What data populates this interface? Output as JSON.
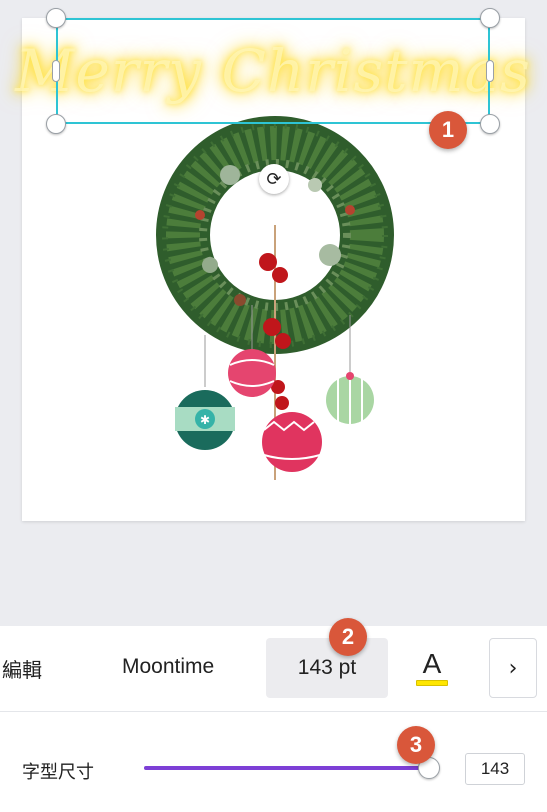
{
  "canvas": {
    "text_element": "Merry Christmas",
    "wreath_image": "christmas-wreath-with-ornaments",
    "rotate_icon": "rotate-icon"
  },
  "annotations": {
    "marker_1": "1",
    "marker_2": "2",
    "marker_3": "3"
  },
  "toolbar": {
    "edit_label": "編輯",
    "font_name": "Moontime",
    "font_size": "143 pt",
    "text_color_letter": "A",
    "text_color": "#ffe600",
    "next_icon": "chevron-right-icon",
    "next_glyph": "›"
  },
  "size_slider": {
    "label": "字型尺寸",
    "value": "143",
    "fill_fraction": 0.99,
    "accent": "#7d3fd6"
  },
  "colors": {
    "selection": "#2ec4d4",
    "marker": "#d9573a",
    "background": "#ebecf0"
  }
}
